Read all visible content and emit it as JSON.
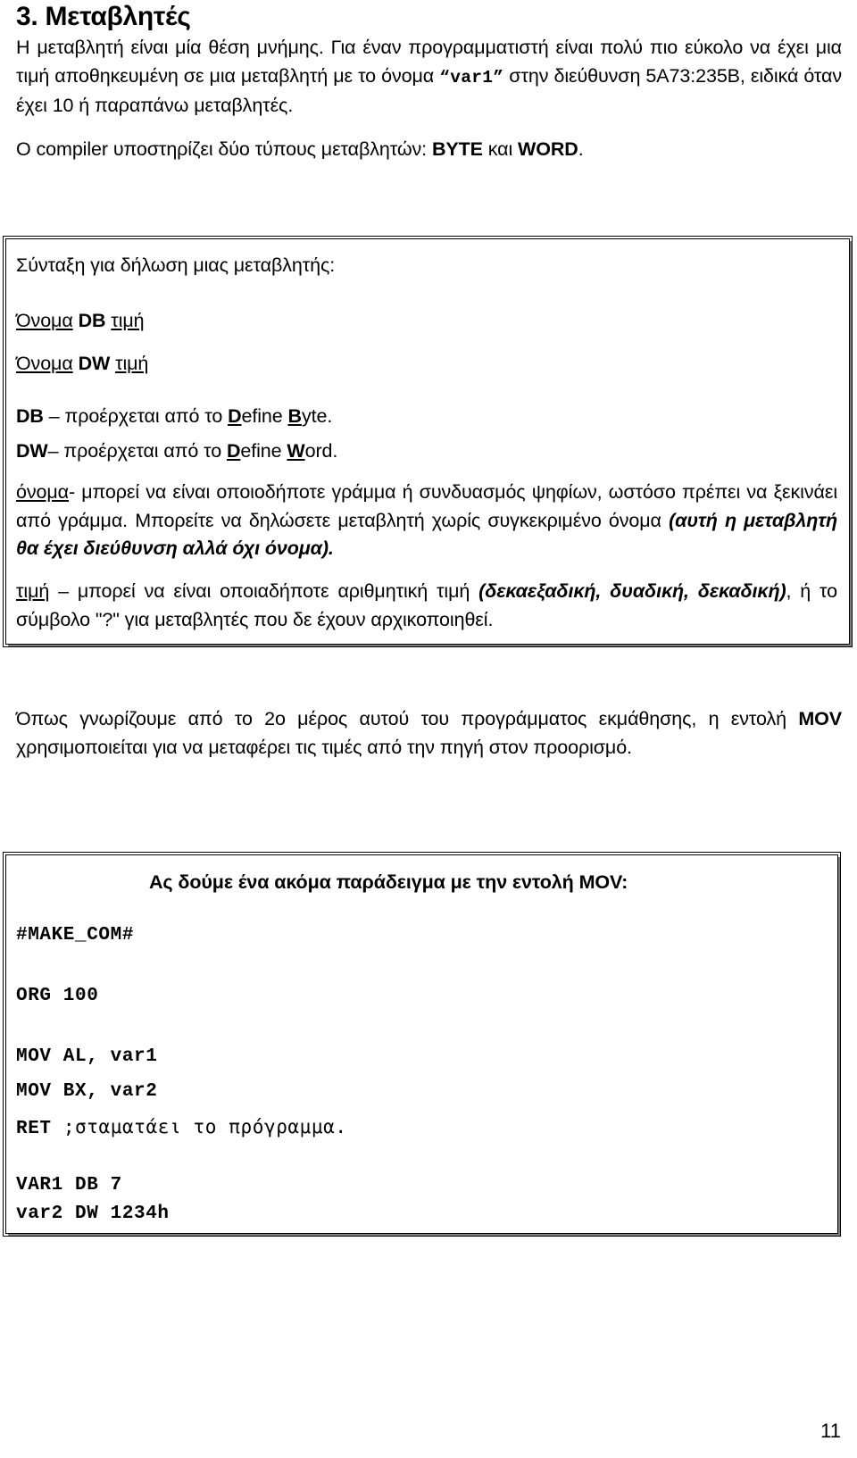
{
  "document": {
    "heading": "3. Μεταβλητές",
    "page_number": "11",
    "intro": {
      "part1": "Η μεταβλητή είναι μία θέση μνήμης. Για έναν προγραμματιστή είναι πολύ πιο εύκολο να έχει μια τιμή αποθηκευμένη σε μια μεταβλητή με το όνομα ",
      "varname": "“var1”",
      "part2": " στην διεύθυνση 5A73:235B, ειδικά όταν έχει 10 ή παραπάνω μεταβλητές."
    },
    "compiler_line": {
      "prefix": "Ο compiler υποστηρίζει δύο τύπους μεταβλητών: ",
      "type_byte": "BYTE",
      "conjunction": " και ",
      "type_word": "WORD",
      "suffix": "."
    },
    "box1": {
      "syntax_intro": "Σύνταξη για δήλωση μιας μεταβλητής:",
      "syntax_db": {
        "name": "Όνομα",
        "keyword": "DB",
        "value": "τιμή"
      },
      "syntax_dw": {
        "name": "Όνομα",
        "keyword": "DW",
        "value": "τιμή"
      },
      "db_def": {
        "keyword": "DB",
        "dash": " – προέρχεται από το ",
        "d": "D",
        "efine": "efine ",
        "b": "B",
        "yte": "yte."
      },
      "dw_def": {
        "keyword": "DW",
        "dash": "– προέρχεται από το ",
        "d": "D",
        "efine": "efine ",
        "w": "W",
        "ord": "ord."
      },
      "onoma": {
        "term": "όνομα",
        "text": "- μπορεί να είναι οποιοδήποτε γράμμα ή συνδυασμός ψηφίων, ωστόσο πρέπει να ξεκινάει από γράμμα. Μπορείτε να δηλώσετε μεταβλητή χωρίς συγκεκριμένο όνομα ",
        "italic": "(αυτή η μεταβλητή θα έχει διεύθυνση αλλά όχι όνομα)."
      },
      "timi": {
        "term": "τιμή",
        "text1": " – μπορεί να είναι οποιαδήποτε αριθμητική τιμή ",
        "italic1": "(δεκαεξαδική, δυαδική, δεκαδική)",
        "text2": ", ή το σύμβολο \"?\" για μεταβλητές που δε έχουν αρχικοποιηθεί."
      }
    },
    "mov_paragraph": {
      "part1": "Όπως γνωρίζουμε από το 2ο μέρος αυτού του προγράμματος εκμάθησης, η εντολή ",
      "mov": "MOV",
      "part2": " χρησιμοποιείται για να μεταφέρει τις τιμές από την πηγή στον προορισμό."
    },
    "box2": {
      "title": "Ας δούμε ένα ακόμα παράδειγμα με την εντολή MOV:",
      "code_lines": [
        "#MAKE_COM#",
        "",
        "ORG 100",
        "",
        "MOV AL, var1",
        "MOV BX, var2",
        "RET ;σταματάει το πρόγραμμα.",
        "",
        "VAR1 DB 7",
        "var2 DW 1234h"
      ],
      "code_ret_prefix": "RET ",
      "code_ret_comment": ";σταματάει το πρόγραμμα."
    }
  }
}
